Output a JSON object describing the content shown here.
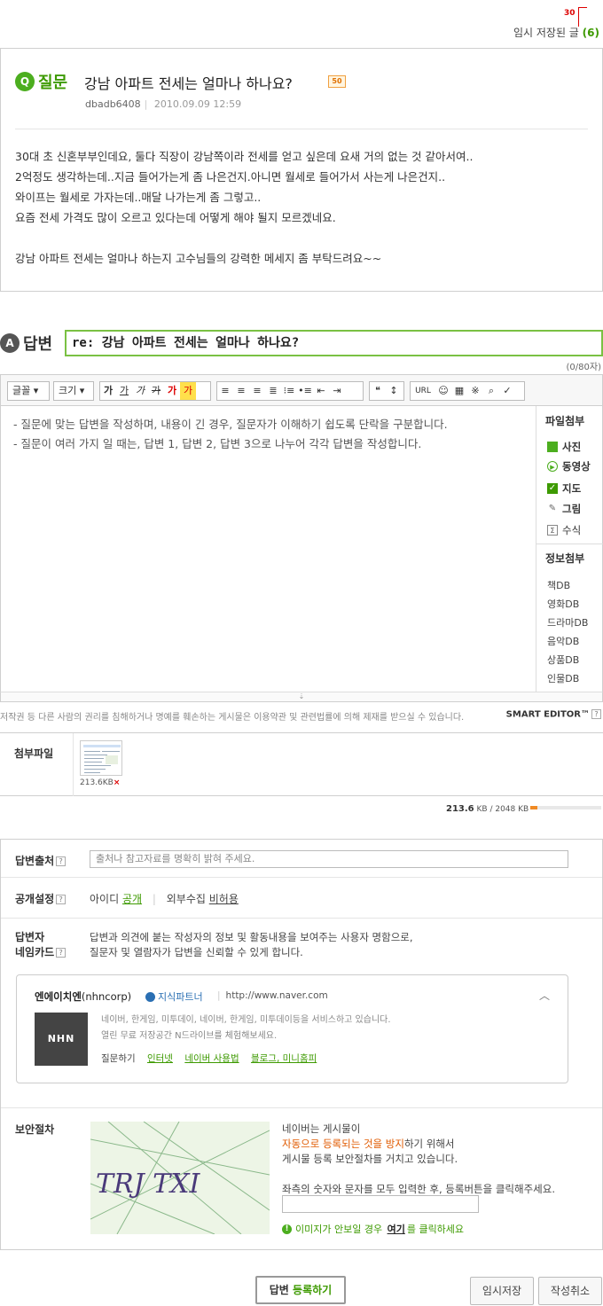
{
  "top": {
    "marker_count": "30",
    "temp_saved_label": "임시 저장된 글",
    "temp_saved_count": "(6)"
  },
  "question": {
    "badge": "Q",
    "label": "질문",
    "title": "강남 아파트 전세는 얼마나 하나요?",
    "points": "50",
    "author": "dbadb6408",
    "date": "2010.09.09 12:59",
    "body": [
      "30대 초 신혼부부인데요, 둘다 직장이 강남쪽이라 전세를 얻고 싶은데 요새 거의 없는 것 같아서여..",
      "2억정도 생각하는데..지금 들어가는게 좀 나은건지.아니면 월세로 들어가서 사는게 나은건지..",
      "와이프는 월세로 가자는데..매달 나가는게 좀 그렇고..",
      "요즘 전세 가격도 많이 오르고 있다는데 어떻게 해야 될지 모르겠네요.",
      "",
      "강남 아파트 전세는 얼마나 하는지 고수님들의 강력한 메세지 좀 부탁드려요~~"
    ]
  },
  "answer": {
    "badge": "A",
    "label": "답변",
    "title_value": "re: 강남 아파트 전세는 얼마나 하나요?",
    "char_count": "(0/80자)"
  },
  "toolbar": {
    "font_select": "글꼴",
    "size_select": "크기",
    "style_buttons": [
      "가",
      "가",
      "가",
      "가",
      "가",
      "가"
    ],
    "url_label": "URL"
  },
  "editor": {
    "guide_lines": [
      "- 질문에 맞는 답변을 작성하며, 내용이 긴 경우, 질문자가 이해하기 쉽도록 단락을 구분합니다.",
      "- 질문이 여러 가지 일 때는, 답변 1, 답변 2, 답변 3으로 나누어 각각 답변을 작성합니다."
    ],
    "file_attach_heading": "파일첨부",
    "file_items": [
      {
        "label": "사진",
        "icon": "photo-icon"
      },
      {
        "label": "동영상",
        "icon": "video-icon"
      },
      {
        "label": "지도",
        "icon": "map-icon"
      },
      {
        "label": "그림",
        "icon": "brush-icon"
      },
      {
        "label": "수식",
        "icon": "sigma-icon"
      }
    ],
    "info_attach_heading": "정보첨부",
    "db_items": [
      "책DB",
      "영화DB",
      "드라마DB",
      "음악DB",
      "상품DB",
      "인물DB"
    ]
  },
  "notice": "저작권 등 다른 사람의 권리를 침해하거나 명예를 훼손하는 게시물은 이용약관 및 관련법률에 의해 제재를 받으실 수 있습니다.",
  "smart_editor": "SMART EDITOR™",
  "attachments": {
    "label": "첨부파일",
    "file_size": "213.6KB",
    "remove": "×"
  },
  "capacity": {
    "used": "213.6",
    "used_unit": "KB",
    "total": "2048 KB",
    "used_fraction": 0.104
  },
  "form": {
    "source_label": "답변출처",
    "source_placeholder": "출처나 참고자료를 명확히 밝혀 주세요.",
    "public_label": "공개설정",
    "id_label": "아이디",
    "id_value": "공개",
    "external_label": "외부수집",
    "external_value": "비허용",
    "card_label_1": "답변자",
    "card_label_2": "네임카드",
    "card_desc_1": "답변과 의견에 붙는 작성자의 정보 및 활동내용을 보여주는 사용자 명함으로,",
    "card_desc_2": "질문자 및 열람자가 답변을 신뢰할 수 있게 합니다.",
    "card": {
      "name": "엔에이치엔",
      "name_en": "(nhncorp)",
      "partner": "지식파트너",
      "url": "http://www.naver.com",
      "logo_text": "NHN",
      "text_1": "네이버, 한게임, 미투데이, 네이버, 한게임, 미투데이등을 서비스하고 있습니다.",
      "text_2": "열린 무료 저장공간 N드라이브를 체험해보세요.",
      "ask_label": "질문하기",
      "links": [
        "인터넷",
        "네이버 사용법",
        "블로그, 미니홈피"
      ]
    },
    "security_label": "보안절차",
    "captcha_text": "TRJ TXI",
    "sec_line_1": "네이버는 게시물이",
    "sec_line_2_highlight": "자동으로 등록되는 것을 방지",
    "sec_line_2_rest": "하기 위해서",
    "sec_line_3": "게시물 등록 보안절차를 거치고 있습니다.",
    "sec_line_4": "좌측의 숫자와 문자를 모두 입력한 후, 등록버튼을 클릭해주세요.",
    "sec_help_pre": "이미지가 안보일 경우",
    "sec_help_link": "여기",
    "sec_help_post": "를 클릭하세요"
  },
  "buttons": {
    "submit_pre": "답변",
    "submit_post": "등록하기",
    "temp_save": "임시저장",
    "cancel": "작성취소"
  }
}
